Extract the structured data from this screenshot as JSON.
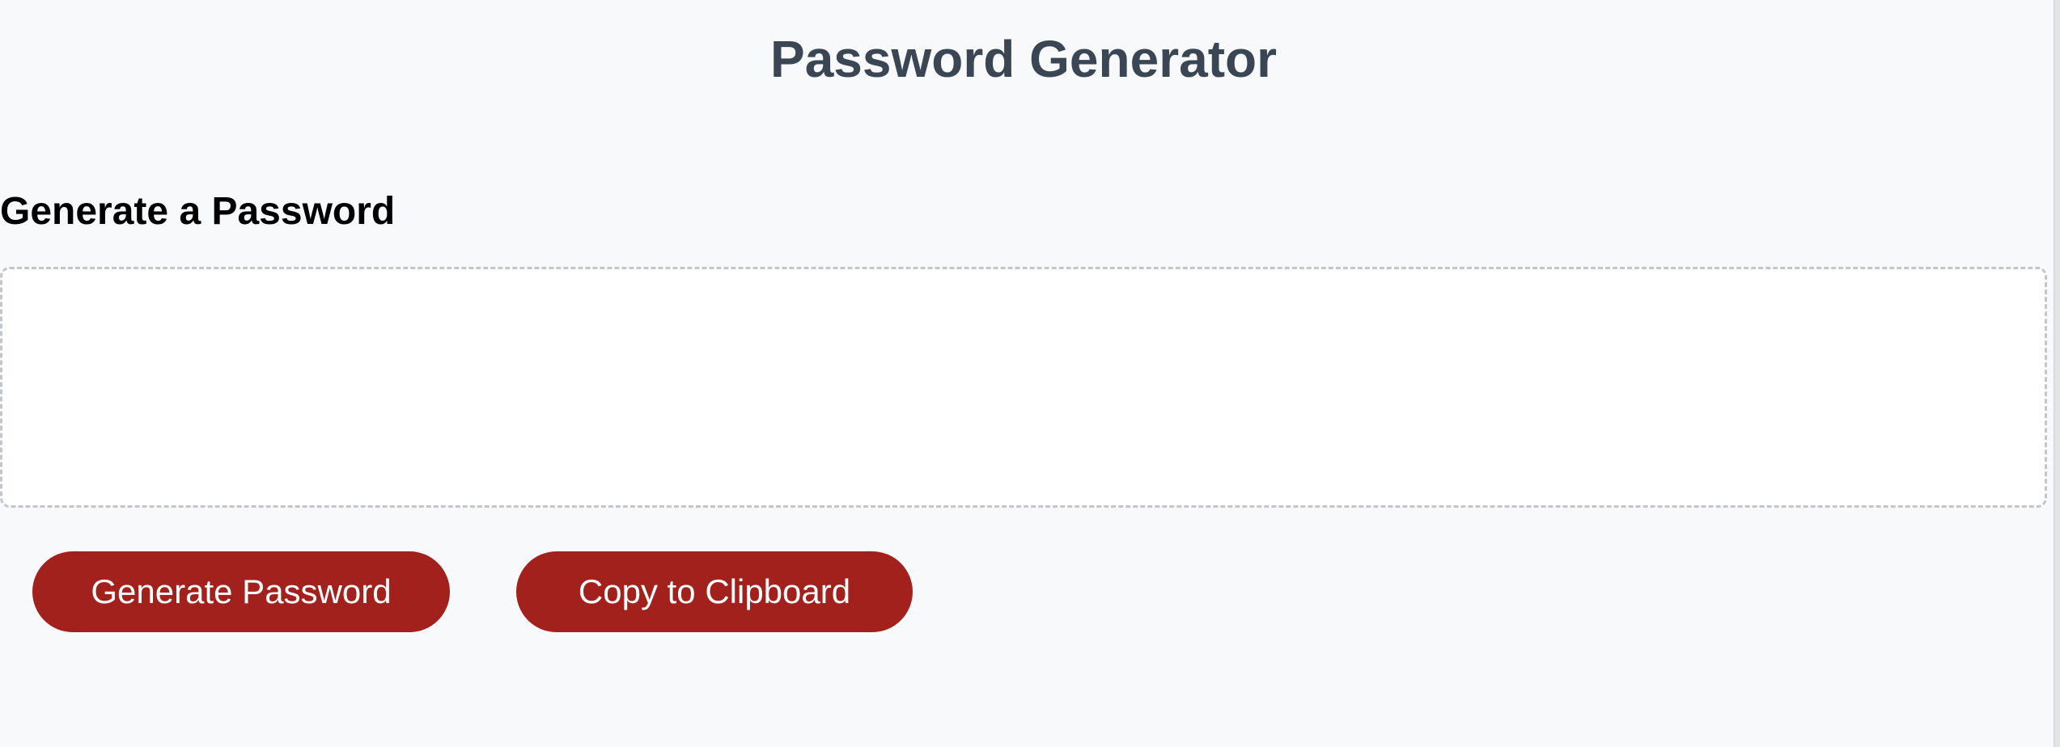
{
  "header": {
    "title": "Password Generator"
  },
  "card": {
    "heading": "Generate a Password",
    "password_value": "",
    "password_placeholder": ""
  },
  "actions": {
    "generate_label": "Generate Password",
    "copy_label": "Copy to Clipboard"
  },
  "colors": {
    "background": "#f8f9fb",
    "title_text": "#3b4654",
    "button": "#a3211c",
    "button_text": "#ffffff",
    "dashed_border": "#c3c6cb"
  }
}
